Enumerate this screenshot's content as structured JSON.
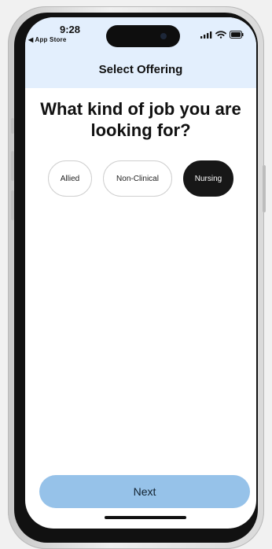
{
  "status_bar": {
    "time": "9:28",
    "back_app_label": "◀ App Store"
  },
  "header": {
    "title": "Select Offering"
  },
  "main": {
    "question": "What kind of job you are looking for?",
    "options": [
      {
        "label": "Allied",
        "selected": false
      },
      {
        "label": "Non-Clinical",
        "selected": false
      },
      {
        "label": "Nursing",
        "selected": true
      }
    ]
  },
  "footer": {
    "next_label": "Next"
  },
  "colors": {
    "header_bg": "#e3effd",
    "selected_option": "#171717",
    "button_bg": "#96c2e9"
  },
  "icons": {
    "signal": "cellular-signal-icon",
    "wifi": "wifi-icon",
    "battery": "battery-icon"
  }
}
